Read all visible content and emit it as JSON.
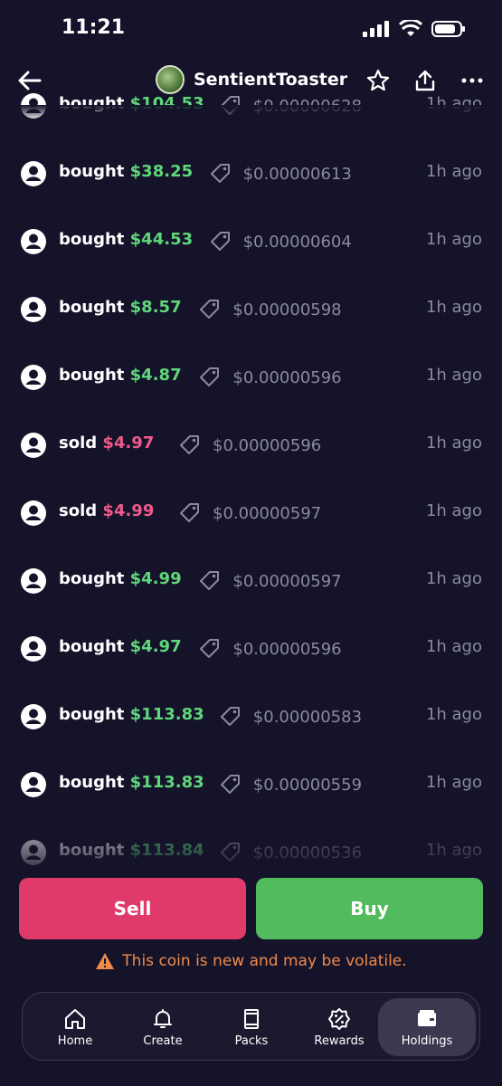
{
  "status": {
    "time": "11:21"
  },
  "header": {
    "title": "SentientToaster"
  },
  "trades": [
    {
      "action": "bought",
      "amount": "$104.53",
      "type": "buy",
      "price": "$0.00000628",
      "time": "1h ago"
    },
    {
      "action": "bought",
      "amount": "$38.25",
      "type": "buy",
      "price": "$0.00000613",
      "time": "1h ago"
    },
    {
      "action": "bought",
      "amount": "$44.53",
      "type": "buy",
      "price": "$0.00000604",
      "time": "1h ago"
    },
    {
      "action": "bought",
      "amount": "$8.57",
      "type": "buy",
      "price": "$0.00000598",
      "time": "1h ago"
    },
    {
      "action": "bought",
      "amount": "$4.87",
      "type": "buy",
      "price": "$0.00000596",
      "time": "1h ago"
    },
    {
      "action": "sold",
      "amount": "$4.97",
      "type": "sell",
      "price": "$0.00000596",
      "time": "1h ago"
    },
    {
      "action": "sold",
      "amount": "$4.99",
      "type": "sell",
      "price": "$0.00000597",
      "time": "1h ago"
    },
    {
      "action": "bought",
      "amount": "$4.99",
      "type": "buy",
      "price": "$0.00000597",
      "time": "1h ago"
    },
    {
      "action": "bought",
      "amount": "$4.97",
      "type": "buy",
      "price": "$0.00000596",
      "time": "1h ago"
    },
    {
      "action": "bought",
      "amount": "$113.83",
      "type": "buy",
      "price": "$0.00000583",
      "time": "1h ago"
    },
    {
      "action": "bought",
      "amount": "$113.83",
      "type": "buy",
      "price": "$0.00000559",
      "time": "1h ago"
    },
    {
      "action": "bought",
      "amount": "$113.84",
      "type": "buy",
      "price": "$0.00000536",
      "time": "1h ago"
    }
  ],
  "actions": {
    "sell_label": "Sell",
    "buy_label": "Buy"
  },
  "warning": {
    "text": "This coin is new and may be volatile."
  },
  "nav": {
    "items": [
      {
        "label": "Home",
        "icon": "home-icon"
      },
      {
        "label": "Create",
        "icon": "bell-icon"
      },
      {
        "label": "Packs",
        "icon": "pack-icon"
      },
      {
        "label": "Rewards",
        "icon": "percent-badge-icon"
      },
      {
        "label": "Holdings",
        "icon": "wallet-icon"
      }
    ],
    "active": "Holdings"
  },
  "colors": {
    "background": "#14132a",
    "buy": "#5fd77a",
    "sell": "#ef5a8a",
    "sell_button": "#e03a6b",
    "buy_button": "#52bb5e",
    "warning": "#f08a4a"
  }
}
